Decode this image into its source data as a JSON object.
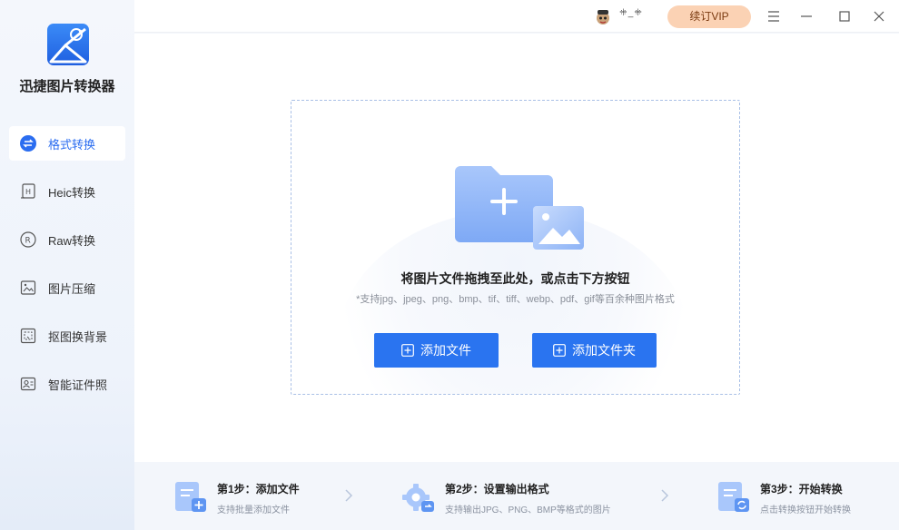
{
  "app": {
    "name": "迅捷图片转换器"
  },
  "sidebar": {
    "items": [
      {
        "label": "格式转换",
        "icon": "swap-icon",
        "active": true
      },
      {
        "label": "Heic转换",
        "icon": "heic-file-icon",
        "active": false
      },
      {
        "label": "Raw转换",
        "icon": "raw-circle-icon",
        "active": false
      },
      {
        "label": "图片压缩",
        "icon": "image-compress-icon",
        "active": false
      },
      {
        "label": "抠图换背景",
        "icon": "cutout-icon",
        "active": false
      },
      {
        "label": "智能证件照",
        "icon": "id-photo-icon",
        "active": false
      }
    ]
  },
  "topbar": {
    "username": "ꔰ_ꔰ",
    "vip_label": "续订VIP",
    "menu_icon": "menu-icon",
    "minimize_icon": "minimize-icon",
    "maximize_icon": "maximize-icon",
    "close_icon": "close-icon"
  },
  "dropzone": {
    "title": "将图片文件拖拽至此处，或点击下方按钮",
    "subtitle": "*支持jpg、jpeg、png、bmp、tif、tiff、webp、pdf、gif等百余种图片格式",
    "add_file_label": "添加文件",
    "add_folder_label": "添加文件夹"
  },
  "steps": [
    {
      "title": "第1步：添加文件",
      "desc": "支持批量添加文件"
    },
    {
      "title": "第2步：设置输出格式",
      "desc": "支持输出JPG、PNG、BMP等格式的图片"
    },
    {
      "title": "第3步：开始转换",
      "desc": "点击转换按钮开始转换"
    }
  ],
  "colors": {
    "accent": "#2a74f0",
    "vip_bg": "#fbd2b4",
    "sidebar_bg": "#f0f4fb"
  }
}
